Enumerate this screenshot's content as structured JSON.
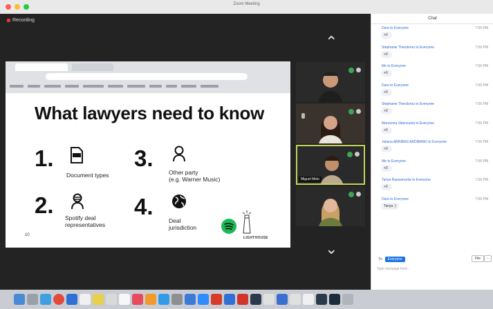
{
  "window": {
    "title_line1": "",
    "title_line2": "Zoom Meeting"
  },
  "recording": {
    "label": "Recording"
  },
  "slide": {
    "title": "What lawyers need to know",
    "items": [
      {
        "num": "1.",
        "label": "Document types",
        "icon": "file-icon"
      },
      {
        "num": "3.",
        "label": "Other party\n(e.g. Warner Music)",
        "icon": "person-icon"
      },
      {
        "num": "2.",
        "label": "Spotify deal\nrepresentatives",
        "icon": "person-group-icon"
      },
      {
        "num": "4.",
        "label": "Deal\njurisdiction",
        "icon": "globe-icon"
      }
    ],
    "slide_number": "10",
    "logo_text": "LIGHTHOUSE"
  },
  "participants": [
    {
      "name": ""
    },
    {
      "name": ""
    },
    {
      "name": "Miguel Melo",
      "active": true
    },
    {
      "name": ""
    }
  ],
  "chat": {
    "header": "Chat",
    "messages": [
      {
        "from": "Dara to Everyone",
        "time": "7:55 PM",
        "text": "+0"
      },
      {
        "from": "Stephanie Theodorou to Everyone",
        "time": "7:56 PM",
        "text": "+0"
      },
      {
        "from": "Me to Everyone",
        "time": "7:56 PM",
        "text": "+0"
      },
      {
        "from": "Dara to Everyone",
        "time": "7:56 PM",
        "text": "+0"
      },
      {
        "from": "Stephanie Theodorou to Everyone",
        "time": "7:56 PM",
        "text": "+0"
      },
      {
        "from": "Marzenna Valenzuela to Everyone",
        "time": "7:56 PM",
        "text": "+0"
      },
      {
        "from": "Juliana ARRIBAS ARDIBANO to Everyone",
        "time": "7:56 PM",
        "text": "+0"
      },
      {
        "from": "Me to Everyone",
        "time": "7:56 PM",
        "text": "+0"
      },
      {
        "from": "Tanya Rassamonte to Everyone",
        "time": "7:56 PM",
        "text": "+0"
      },
      {
        "from": "Dara to Everyone",
        "time": "7:56 PM",
        "text": "Tanya :)"
      }
    ],
    "to_label": "To:",
    "to_value": "Everyone",
    "file_label": "File",
    "input_placeholder": "Type message here..."
  }
}
